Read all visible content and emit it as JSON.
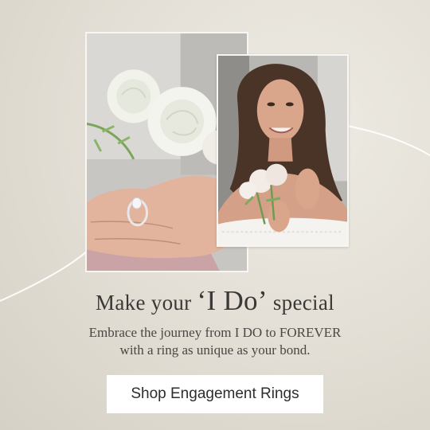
{
  "headline": {
    "before": "Make your ",
    "emphasis": "‘I Do’",
    "after": " special"
  },
  "subtext": {
    "line1": "Embrace the journey from I DO to FOREVER",
    "line2": "with a ring as unique as your bond."
  },
  "cta": {
    "label": "Shop Engagement Rings"
  },
  "colors": {
    "background": "#e4e0d7",
    "text": "#3b3936",
    "button_bg": "#ffffff",
    "swoosh": "#ffffff"
  },
  "images": {
    "left": "hand-with-ring-and-roses-photo",
    "right": "woman-holding-roses-photo"
  }
}
